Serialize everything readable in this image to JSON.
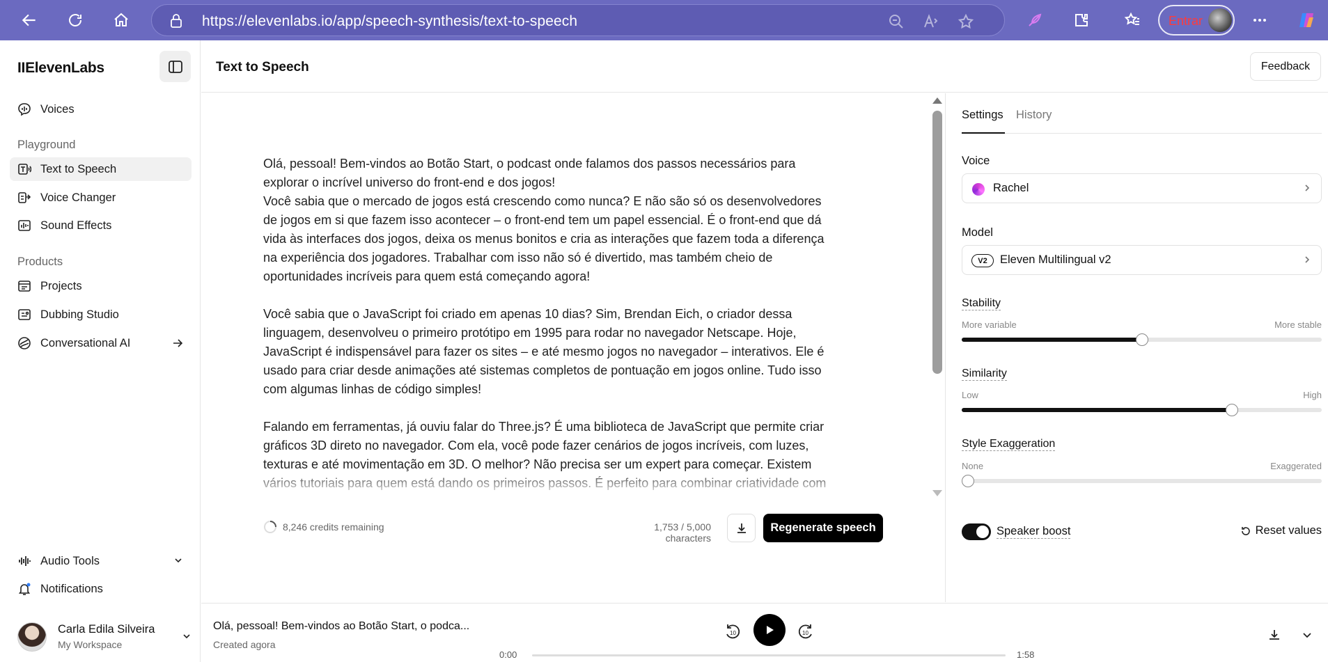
{
  "browser": {
    "url": "https://elevenlabs.io/app/speech-synthesis/text-to-speech",
    "signin_label": "Entrar"
  },
  "sidebar": {
    "logo": "IIElevenLabs",
    "top_item": {
      "label": "Voices",
      "icon": "voices-icon"
    },
    "sections": [
      {
        "title": "Playground",
        "items": [
          {
            "label": "Text to Speech",
            "icon": "text-to-speech-icon",
            "active": true
          },
          {
            "label": "Voice Changer",
            "icon": "voice-changer-icon"
          },
          {
            "label": "Sound Effects",
            "icon": "sound-effects-icon"
          }
        ]
      },
      {
        "title": "Products",
        "items": [
          {
            "label": "Projects",
            "icon": "projects-icon"
          },
          {
            "label": "Dubbing Studio",
            "icon": "dubbing-icon"
          },
          {
            "label": "Conversational AI",
            "icon": "conversational-icon"
          }
        ]
      }
    ],
    "bottom": {
      "audio_tools": "Audio Tools",
      "notifications": "Notifications"
    },
    "user": {
      "name": "Carla Edila Silveira",
      "workspace": "My Workspace"
    }
  },
  "header": {
    "title": "Text to Speech",
    "feedback": "Feedback"
  },
  "editor": {
    "text": "Olá, pessoal! Bem-vindos ao Botão Start, o podcast onde falamos dos passos necessários para\nexplorar o incrível universo do front-end e dos jogos!\nVocê sabia que o mercado de jogos está crescendo como nunca? E não são só os desenvolvedores\nde jogos em si que fazem isso acontecer – o front-end tem um papel essencial. É o front-end que dá\nvida às interfaces dos jogos, deixa os menus bonitos e cria as interações que fazem toda a diferença\nna experiência dos jogadores. Trabalhar com isso não só é divertido, mas também cheio de\noportunidades incríveis para quem está começando agora!\n\nVocê sabia que o JavaScript foi criado em apenas 10 dias? Sim, Brendan Eich, o criador dessa\nlinguagem, desenvolveu o primeiro protótipo em 1995 para rodar no navegador Netscape. Hoje,\nJavaScript é indispensável para fazer os sites – e até mesmo jogos no navegador – interativos. Ele é\nusado para criar desde animações até sistemas completos de pontuação em jogos online. Tudo isso\ncom algumas linhas de código simples!\n\nFalando em ferramentas, já ouviu falar do Three.js? É uma biblioteca de JavaScript que permite criar\ngráficos 3D direto no navegador. Com ela, você pode fazer cenários de jogos incríveis, com luzes,\ntexturas e até movimentação em 3D. O melhor? Não precisa ser um expert para começar. Existem\nvários tutoriais para quem está dando os primeiros passos. É perfeito para combinar criatividade com",
    "credits": "8,246 credits remaining",
    "char_count": "1,753 / 5,000 characters",
    "regenerate": "Regenerate speech"
  },
  "settings": {
    "tabs": [
      "Settings",
      "History"
    ],
    "voice_label": "Voice",
    "voice_value": "Rachel",
    "model_label": "Model",
    "model_badge": "V2",
    "model_value": "Eleven Multilingual v2",
    "sliders": [
      {
        "label": "Stability",
        "min": "More variable",
        "max": "More stable",
        "value": 0.5
      },
      {
        "label": "Similarity",
        "min": "Low",
        "max": "High",
        "value": 0.75
      },
      {
        "label": "Style Exaggeration",
        "min": "None",
        "max": "Exaggerated",
        "value": 0.0
      }
    ],
    "speaker_boost": "Speaker boost",
    "speaker_boost_on": true,
    "reset": "Reset values"
  },
  "player": {
    "title": "Olá, pessoal! Bem-vindos ao Botão Start, o podca...",
    "subtitle": "Created agora",
    "time_current": "0:00",
    "time_total": "1:58"
  }
}
